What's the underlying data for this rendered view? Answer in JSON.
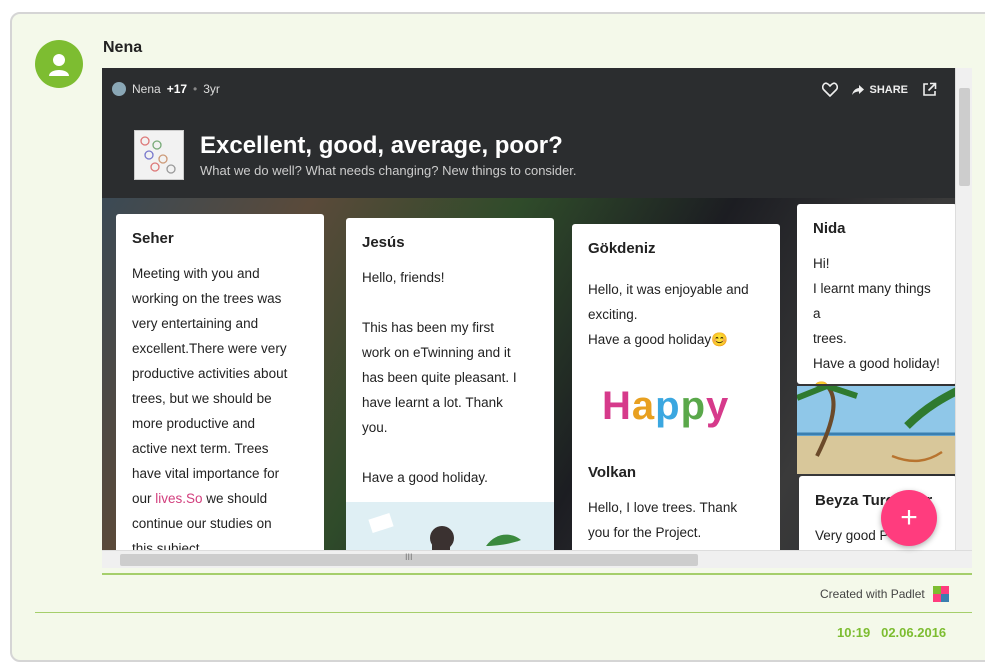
{
  "post": {
    "author": "Nena",
    "time": "10:19",
    "date": "02.06.2016"
  },
  "padlet": {
    "author": "Nena",
    "plus": "+17",
    "dot": "•",
    "age": "3yr",
    "share_label": "SHARE",
    "title": "Excellent, good, average, poor?",
    "subtitle": "What we do well? What needs changing? New things to consider.",
    "brand": "Created with Padlet"
  },
  "cards": {
    "seher": {
      "name": "Seher",
      "text_a": "Meeting with you and\nworking on the trees was\nvery entertaining and\nexcellent.There were very\nproductive activities about\ntrees, but we should be\nmore productive and\nactive next term. Trees\nhave vital importance for\nour ",
      "link": "lives.So",
      "text_b": " we should\ncontinue our studies on\nthis subject."
    },
    "jesus": {
      "name": "Jesús",
      "text": "Hello, friends!\n\nThis has been my first\nwork on eTwinning and it\nhas been quite pleasant. I\nhave learnt a lot. Thank\nyou.\n\nHave a good holiday."
    },
    "gokdeniz": {
      "name": "Gökdeniz",
      "text": "Hello, it was enjoyable and\nexciting.\nHave a good holiday😊",
      "image_text": "Happy"
    },
    "volkan": {
      "name": "Volkan",
      "text": "Hello, I love trees. Thank\nyou for the Project."
    },
    "nida": {
      "name": "Nida",
      "text": "Hi!\nI learnt many things a\ntrees.\nHave a good holiday!😊\n😄"
    },
    "beyza": {
      "name": "Beyza Turg",
      "name_tail": "ur",
      "text": "Very good P"
    }
  },
  "scroll": {
    "h_mark": "III"
  },
  "colors": {
    "accent_green": "#7dbd31",
    "fab_pink": "#ff3c7e",
    "link_pink": "#d23e7d",
    "padlet_dark": "#2b2d2f"
  },
  "icons": [
    "user-icon",
    "globe-icon",
    "heart-icon",
    "share-icon",
    "open-external-icon",
    "plus-icon",
    "padlet-logo-icon"
  ]
}
